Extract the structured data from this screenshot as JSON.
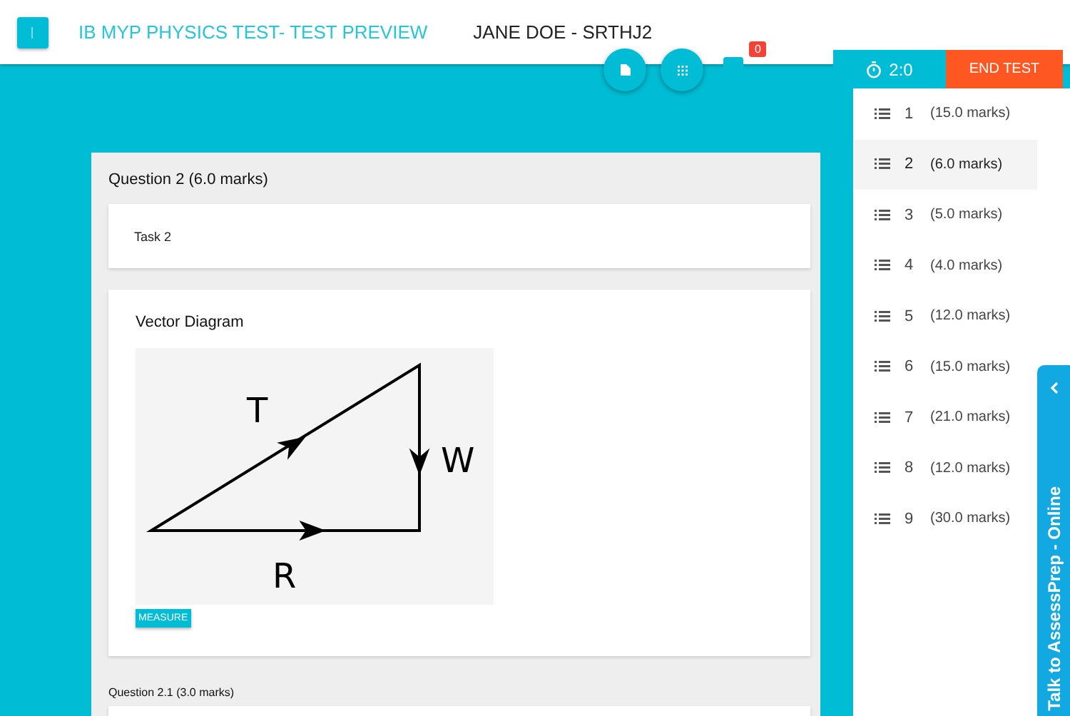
{
  "header": {
    "title": "IB MYP PHYSICS TEST- TEST PREVIEW",
    "student": "JANE DOE - SRTHJ2",
    "notification_count": "0"
  },
  "timer": {
    "time": "2:0",
    "end_button": "END TEST"
  },
  "question": {
    "title": "Question 2 (6.0 marks)",
    "task": "Task 2",
    "diagram_title": "Vector Diagram",
    "diagram_labels": [
      "T",
      "W",
      "R"
    ],
    "measure_button": "MEASURE",
    "subquestion_title": "Question 2.1  (3.0 marks)"
  },
  "questions": [
    {
      "number": "1",
      "marks": "(15.0 marks)",
      "selected": false
    },
    {
      "number": "2",
      "marks": "(6.0 marks)",
      "selected": true
    },
    {
      "number": "3",
      "marks": "(5.0 marks)",
      "selected": false
    },
    {
      "number": "4",
      "marks": "(4.0 marks)",
      "selected": false
    },
    {
      "number": "5",
      "marks": "(12.0 marks)",
      "selected": false
    },
    {
      "number": "6",
      "marks": "(15.0 marks)",
      "selected": false
    },
    {
      "number": "7",
      "marks": "(21.0 marks)",
      "selected": false
    },
    {
      "number": "8",
      "marks": "(12.0 marks)",
      "selected": false
    },
    {
      "number": "9",
      "marks": "(30.0 marks)",
      "selected": false
    }
  ],
  "chat": {
    "label": "Talk to AssessPrep - Online"
  }
}
